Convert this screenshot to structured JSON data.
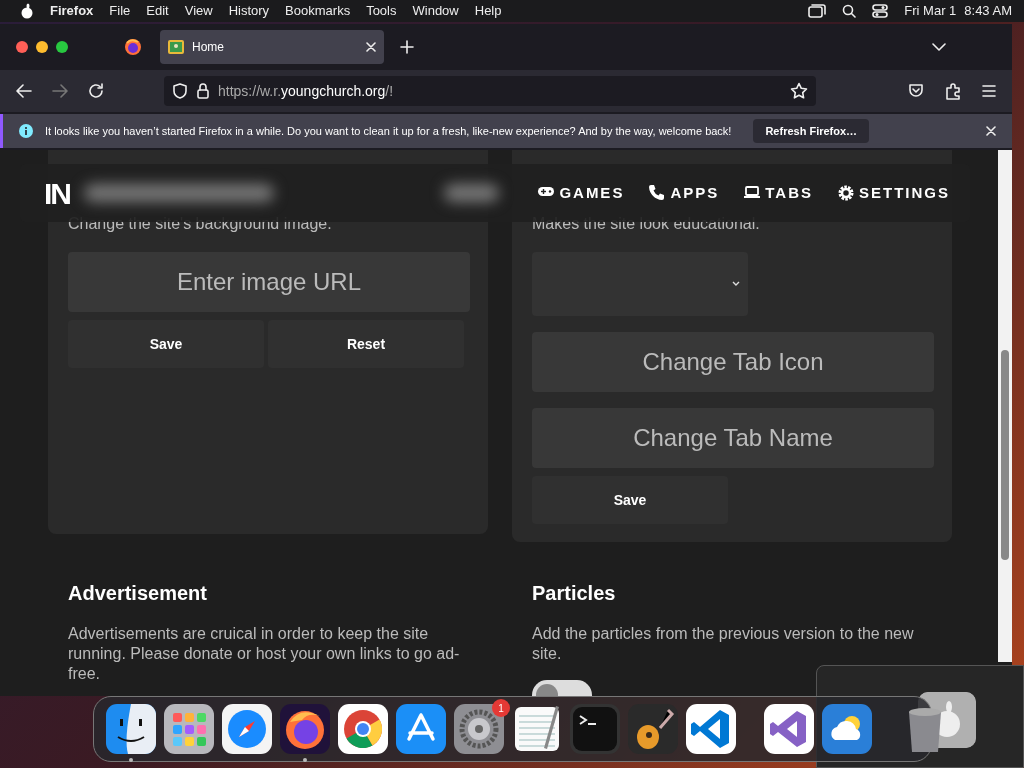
{
  "menubar": {
    "app": "Firefox",
    "items": [
      "File",
      "Edit",
      "View",
      "History",
      "Bookmarks",
      "Tools",
      "Window",
      "Help"
    ],
    "date": "Fri Mar 1",
    "time": "8:43 AM"
  },
  "tabs": [
    {
      "title": "Home",
      "selected": true
    }
  ],
  "address": {
    "prefix": "https://w.r.",
    "domain": "youngchurch.org",
    "suffix": "/!"
  },
  "notification": {
    "text": "It looks like you haven’t started Firefox in a while. Do you want to clean it up for a fresh, like-new experience? And by the way, welcome back!",
    "button": "Refresh Firefox…"
  },
  "site_nav": {
    "logo": "IN",
    "links": [
      {
        "kind": "games",
        "label": "GAMES"
      },
      {
        "kind": "apps",
        "label": "APPS"
      },
      {
        "kind": "tabs",
        "label": "TABS"
      },
      {
        "kind": "settings",
        "label": "SETTINGS"
      }
    ]
  },
  "cards": [
    {
      "description": "Change the site's background image.",
      "fields": [
        {
          "kind": "input",
          "placeholder": "Enter image URL"
        }
      ],
      "buttons": [
        "Save",
        "Reset"
      ]
    },
    {
      "description": "Makes the site look educational.",
      "fields": [
        {
          "kind": "select"
        },
        {
          "kind": "input",
          "placeholder": "Change Tab Icon"
        },
        {
          "kind": "input",
          "placeholder": "Change Tab Name"
        }
      ],
      "buttons": [
        "Save"
      ]
    }
  ],
  "sections": [
    {
      "title": "Advertisement",
      "text": "Advertisements are cruical in order to keep the site running. Please donate or host your own links to go ad-free."
    },
    {
      "title": "Particles",
      "text": "Add the particles from the previous version to the new site.",
      "toggle": {
        "on": false
      }
    }
  ],
  "dock": [
    {
      "kind": "finder",
      "running": true
    },
    {
      "kind": "launchpad",
      "running": false
    },
    {
      "kind": "safari",
      "running": false
    },
    {
      "kind": "firefox",
      "running": true
    },
    {
      "kind": "chrome",
      "running": false
    },
    {
      "kind": "appstore",
      "running": false
    },
    {
      "kind": "settings",
      "running": false,
      "badge": "1"
    },
    {
      "kind": "textedit",
      "running": false
    },
    {
      "kind": "terminal",
      "running": false
    },
    {
      "kind": "garageband",
      "running": false
    },
    {
      "kind": "vscode",
      "running": false
    },
    {
      "kind": "divider"
    },
    {
      "kind": "vstudio",
      "running": false
    },
    {
      "kind": "weather",
      "running": false
    },
    {
      "kind": "divider"
    },
    {
      "kind": "trash",
      "running": false
    }
  ]
}
